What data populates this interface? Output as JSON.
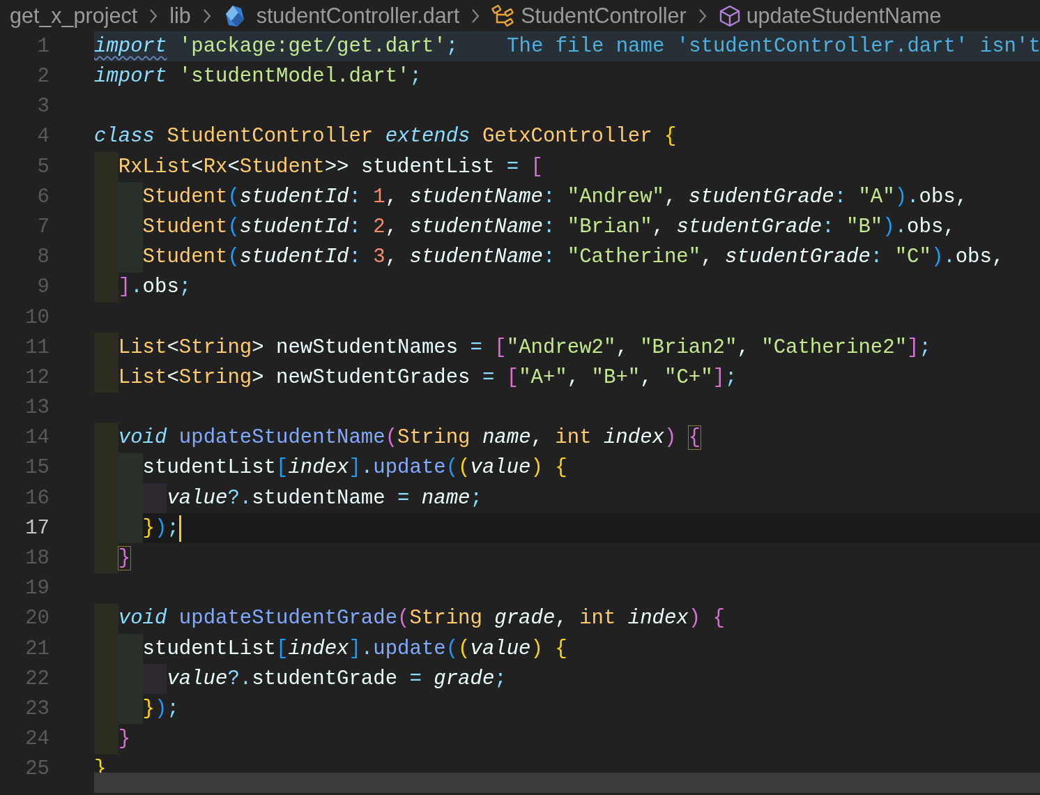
{
  "breadcrumb": [
    {
      "label": "get_x_project",
      "kind": "folder"
    },
    {
      "label": "lib",
      "kind": "folder"
    },
    {
      "label": "studentController.dart",
      "kind": "file"
    },
    {
      "label": "StudentController",
      "kind": "class"
    },
    {
      "label": "updateStudentName",
      "kind": "method"
    }
  ],
  "editor": {
    "lines": [
      {
        "number": "1",
        "tokens": [
          {
            "kind": "keyword",
            "text": "import",
            "warning": true
          },
          {
            "kind": "string",
            "text": " 'package:get/get.dart'"
          },
          {
            "kind": "punct",
            "text": ";"
          }
        ],
        "diagnostic": "The file name 'studentController.dart' isn't"
      },
      {
        "number": "2",
        "tokens": [
          {
            "kind": "keyword",
            "text": "import"
          },
          {
            "kind": "string",
            "text": " 'studentModel.dart'"
          },
          {
            "kind": "punct",
            "text": ";"
          }
        ]
      },
      {
        "number": "3"
      },
      {
        "number": "4",
        "tokens": [
          {
            "kind": "keyword",
            "text": "class"
          },
          {
            "kind": "type",
            "text": " StudentController"
          },
          {
            "kind": "keyword",
            "text": " extends"
          },
          {
            "kind": "type",
            "text": " GetxController"
          },
          {
            "kind": "bracket",
            "text": " {",
            "color": "#ffd700"
          }
        ],
        "children": [
          {
            "number": "5",
            "tokens": [
              {
                "kind": "type",
                "text": "RxList"
              },
              {
                "kind": "plain",
                "text": "<"
              },
              {
                "kind": "type",
                "text": "Rx"
              },
              {
                "kind": "plain",
                "text": "<"
              },
              {
                "kind": "type",
                "text": "Student"
              },
              {
                "kind": "plain",
                "text": ">> studentList"
              },
              {
                "kind": "punct",
                "text": " ="
              },
              {
                "kind": "bracket",
                "text": " [",
                "color": "#da70d6"
              }
            ],
            "children": [
              {
                "number": "6",
                "tokens": [
                  {
                    "kind": "type",
                    "text": "Student"
                  },
                  {
                    "kind": "bracket",
                    "text": "(",
                    "color": "#179fff"
                  },
                  {
                    "kind": "param",
                    "text": "studentId"
                  },
                  {
                    "kind": "punct",
                    "text": ":"
                  },
                  {
                    "kind": "number",
                    "text": " 1"
                  },
                  {
                    "kind": "plain",
                    "text": ","
                  },
                  {
                    "kind": "param",
                    "text": " studentName"
                  },
                  {
                    "kind": "punct",
                    "text": ":"
                  },
                  {
                    "kind": "string",
                    "text": " \"Andrew\""
                  },
                  {
                    "kind": "plain",
                    "text": ","
                  },
                  {
                    "kind": "param",
                    "text": " studentGrade"
                  },
                  {
                    "kind": "punct",
                    "text": ":"
                  },
                  {
                    "kind": "string",
                    "text": " \"A\""
                  },
                  {
                    "kind": "bracket",
                    "text": ")",
                    "color": "#179fff"
                  },
                  {
                    "kind": "punct",
                    "text": "."
                  },
                  {
                    "kind": "plain",
                    "text": "obs,"
                  }
                ]
              },
              {
                "number": "7",
                "tokens": [
                  {
                    "kind": "type",
                    "text": "Student"
                  },
                  {
                    "kind": "bracket",
                    "text": "(",
                    "color": "#179fff"
                  },
                  {
                    "kind": "param",
                    "text": "studentId"
                  },
                  {
                    "kind": "punct",
                    "text": ":"
                  },
                  {
                    "kind": "number",
                    "text": " 2"
                  },
                  {
                    "kind": "plain",
                    "text": ","
                  },
                  {
                    "kind": "param",
                    "text": " studentName"
                  },
                  {
                    "kind": "punct",
                    "text": ":"
                  },
                  {
                    "kind": "string",
                    "text": " \"Brian\""
                  },
                  {
                    "kind": "plain",
                    "text": ","
                  },
                  {
                    "kind": "param",
                    "text": " studentGrade"
                  },
                  {
                    "kind": "punct",
                    "text": ":"
                  },
                  {
                    "kind": "string",
                    "text": " \"B\""
                  },
                  {
                    "kind": "bracket",
                    "text": ")",
                    "color": "#179fff"
                  },
                  {
                    "kind": "punct",
                    "text": "."
                  },
                  {
                    "kind": "plain",
                    "text": "obs,"
                  }
                ]
              },
              {
                "number": "8",
                "tokens": [
                  {
                    "kind": "type",
                    "text": "Student"
                  },
                  {
                    "kind": "bracket",
                    "text": "(",
                    "color": "#179fff"
                  },
                  {
                    "kind": "param",
                    "text": "studentId"
                  },
                  {
                    "kind": "punct",
                    "text": ":"
                  },
                  {
                    "kind": "number",
                    "text": " 3"
                  },
                  {
                    "kind": "plain",
                    "text": ","
                  },
                  {
                    "kind": "param",
                    "text": " studentName"
                  },
                  {
                    "kind": "punct",
                    "text": ":"
                  },
                  {
                    "kind": "string",
                    "text": " \"Catherine\""
                  },
                  {
                    "kind": "plain",
                    "text": ","
                  },
                  {
                    "kind": "param",
                    "text": " studentGrade"
                  },
                  {
                    "kind": "punct",
                    "text": ":"
                  },
                  {
                    "kind": "string",
                    "text": " \"C\""
                  },
                  {
                    "kind": "bracket",
                    "text": ")",
                    "color": "#179fff"
                  },
                  {
                    "kind": "punct",
                    "text": "."
                  },
                  {
                    "kind": "plain",
                    "text": "obs,"
                  }
                ]
              }
            ]
          },
          {
            "number": "9",
            "tokens": [
              {
                "kind": "bracket",
                "text": "]",
                "color": "#da70d6"
              },
              {
                "kind": "punct",
                "text": "."
              },
              {
                "kind": "plain",
                "text": "obs"
              },
              {
                "kind": "punct",
                "text": ";"
              }
            ]
          },
          {
            "number": "10"
          },
          {
            "number": "11",
            "tokens": [
              {
                "kind": "type",
                "text": "List"
              },
              {
                "kind": "plain",
                "text": "<"
              },
              {
                "kind": "type",
                "text": "String"
              },
              {
                "kind": "plain",
                "text": "> newStudentNames"
              },
              {
                "kind": "punct",
                "text": " ="
              },
              {
                "kind": "bracket",
                "text": " [",
                "color": "#da70d6"
              },
              {
                "kind": "string",
                "text": "\"Andrew2\""
              },
              {
                "kind": "plain",
                "text": ","
              },
              {
                "kind": "string",
                "text": " \"Brian2\""
              },
              {
                "kind": "plain",
                "text": ","
              },
              {
                "kind": "string",
                "text": " \"Catherine2\""
              },
              {
                "kind": "bracket",
                "text": "]",
                "color": "#da70d6"
              },
              {
                "kind": "punct",
                "text": ";"
              }
            ]
          },
          {
            "number": "12",
            "tokens": [
              {
                "kind": "type",
                "text": "List"
              },
              {
                "kind": "plain",
                "text": "<"
              },
              {
                "kind": "type",
                "text": "String"
              },
              {
                "kind": "plain",
                "text": "> newStudentGrades"
              },
              {
                "kind": "punct",
                "text": " ="
              },
              {
                "kind": "bracket",
                "text": " [",
                "color": "#da70d6"
              },
              {
                "kind": "string",
                "text": "\"A+\""
              },
              {
                "kind": "plain",
                "text": ","
              },
              {
                "kind": "string",
                "text": " \"B+\""
              },
              {
                "kind": "plain",
                "text": ","
              },
              {
                "kind": "string",
                "text": " \"C+\""
              },
              {
                "kind": "bracket",
                "text": "]",
                "color": "#da70d6"
              },
              {
                "kind": "punct",
                "text": ";"
              }
            ]
          },
          {
            "number": "13"
          },
          {
            "number": "14",
            "tokens": [
              {
                "kind": "keyword",
                "text": "void"
              },
              {
                "kind": "function",
                "text": " updateStudentName"
              },
              {
                "kind": "bracket",
                "text": "(",
                "color": "#da70d6"
              },
              {
                "kind": "type",
                "text": "String"
              },
              {
                "kind": "param",
                "text": " name"
              },
              {
                "kind": "plain",
                "text": ","
              },
              {
                "kind": "type",
                "text": " int"
              },
              {
                "kind": "param",
                "text": " index"
              },
              {
                "kind": "bracket",
                "text": ") ",
                "color": "#da70d6"
              },
              {
                "kind": "bracket",
                "text": "{",
                "color": "#da70d6",
                "matched": true
              }
            ],
            "children": [
              {
                "number": "15",
                "tokens": [
                  {
                    "kind": "plain",
                    "text": "studentList"
                  },
                  {
                    "kind": "bracket",
                    "text": "[",
                    "color": "#179fff"
                  },
                  {
                    "kind": "param",
                    "text": "index"
                  },
                  {
                    "kind": "bracket",
                    "text": "]",
                    "color": "#179fff"
                  },
                  {
                    "kind": "punct",
                    "text": "."
                  },
                  {
                    "kind": "function",
                    "text": "update"
                  },
                  {
                    "kind": "bracket",
                    "text": "(",
                    "color": "#179fff"
                  },
                  {
                    "kind": "bracket",
                    "text": "(",
                    "color": "#ffd700"
                  },
                  {
                    "kind": "param",
                    "text": "value"
                  },
                  {
                    "kind": "bracket",
                    "text": ")",
                    "color": "#ffd700"
                  },
                  {
                    "kind": "bracket",
                    "text": " {",
                    "color": "#ffd700"
                  }
                ],
                "children": [
                  {
                    "number": "16",
                    "tokens": [
                      {
                        "kind": "param",
                        "text": "value"
                      },
                      {
                        "kind": "punct",
                        "text": "?."
                      },
                      {
                        "kind": "plain",
                        "text": "studentName"
                      },
                      {
                        "kind": "punct",
                        "text": " ="
                      },
                      {
                        "kind": "param",
                        "text": " name"
                      },
                      {
                        "kind": "punct",
                        "text": ";"
                      }
                    ]
                  }
                ]
              },
              {
                "number": "17",
                "current": true,
                "tokens": [
                  {
                    "kind": "bracket",
                    "text": "}",
                    "color": "#ffd700"
                  },
                  {
                    "kind": "bracket",
                    "text": ")",
                    "color": "#179fff"
                  },
                  {
                    "kind": "punct",
                    "text": ";"
                  }
                ]
              }
            ]
          },
          {
            "number": "18",
            "tokens": [
              {
                "kind": "bracket",
                "text": "}",
                "color": "#da70d6",
                "matched": true
              }
            ]
          },
          {
            "number": "19"
          },
          {
            "number": "20",
            "tokens": [
              {
                "kind": "keyword",
                "text": "void"
              },
              {
                "kind": "function",
                "text": " updateStudentGrade"
              },
              {
                "kind": "bracket",
                "text": "(",
                "color": "#da70d6"
              },
              {
                "kind": "type",
                "text": "String"
              },
              {
                "kind": "param",
                "text": " grade"
              },
              {
                "kind": "plain",
                "text": ","
              },
              {
                "kind": "type",
                "text": " int"
              },
              {
                "kind": "param",
                "text": " index"
              },
              {
                "kind": "bracket",
                "text": ")",
                "color": "#da70d6"
              },
              {
                "kind": "bracket",
                "text": " {",
                "color": "#da70d6"
              }
            ],
            "children": [
              {
                "number": "21",
                "tokens": [
                  {
                    "kind": "plain",
                    "text": "studentList"
                  },
                  {
                    "kind": "bracket",
                    "text": "[",
                    "color": "#179fff"
                  },
                  {
                    "kind": "param",
                    "text": "index"
                  },
                  {
                    "kind": "bracket",
                    "text": "]",
                    "color": "#179fff"
                  },
                  {
                    "kind": "punct",
                    "text": "."
                  },
                  {
                    "kind": "function",
                    "text": "update"
                  },
                  {
                    "kind": "bracket",
                    "text": "(",
                    "color": "#179fff"
                  },
                  {
                    "kind": "bracket",
                    "text": "(",
                    "color": "#ffd700"
                  },
                  {
                    "kind": "param",
                    "text": "value"
                  },
                  {
                    "kind": "bracket",
                    "text": ")",
                    "color": "#ffd700"
                  },
                  {
                    "kind": "bracket",
                    "text": " {",
                    "color": "#ffd700"
                  }
                ],
                "children": [
                  {
                    "number": "22",
                    "tokens": [
                      {
                        "kind": "param",
                        "text": "value"
                      },
                      {
                        "kind": "punct",
                        "text": "?."
                      },
                      {
                        "kind": "plain",
                        "text": "studentGrade"
                      },
                      {
                        "kind": "punct",
                        "text": " ="
                      },
                      {
                        "kind": "param",
                        "text": " grade"
                      },
                      {
                        "kind": "punct",
                        "text": ";"
                      }
                    ]
                  }
                ]
              },
              {
                "number": "23",
                "tokens": [
                  {
                    "kind": "bracket",
                    "text": "}",
                    "color": "#ffd700"
                  },
                  {
                    "kind": "bracket",
                    "text": ")",
                    "color": "#179fff"
                  },
                  {
                    "kind": "punct",
                    "text": ";"
                  }
                ]
              }
            ]
          },
          {
            "number": "24",
            "tokens": [
              {
                "kind": "bracket",
                "text": "}",
                "color": "#da70d6"
              }
            ]
          }
        ]
      },
      {
        "number": "25",
        "tokens": [
          {
            "kind": "bracket",
            "text": "}",
            "color": "#ffd700"
          }
        ]
      }
    ]
  }
}
